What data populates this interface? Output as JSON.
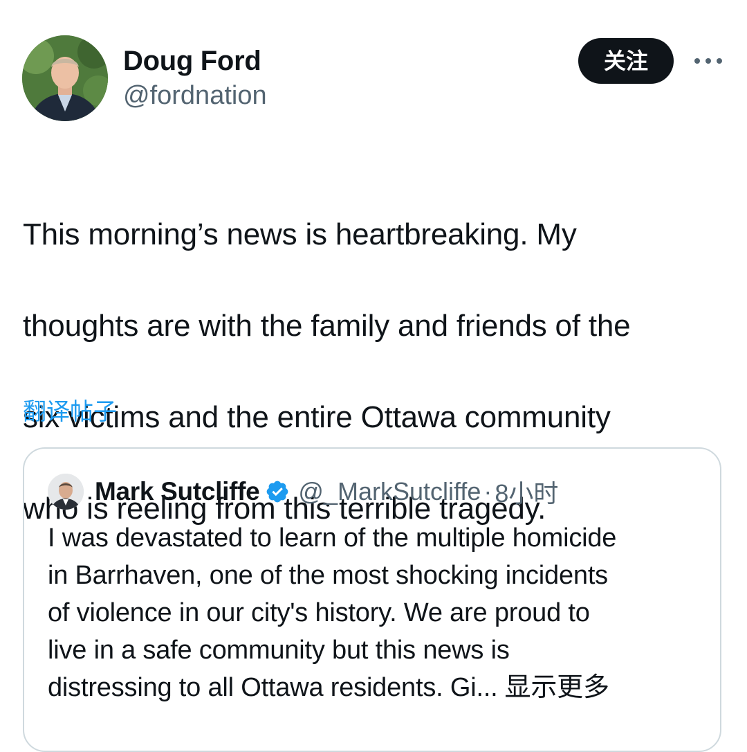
{
  "author": {
    "name": "Doug Ford",
    "handle": "@fordnation",
    "avatar_icon": "profile-photo"
  },
  "actions": {
    "follow_label": "关注",
    "more_icon": "more-horizontal-icon"
  },
  "tweet": {
    "text_lines": [
      "This morning’s news is heartbreaking. My",
      "thoughts are with the family and friends of the",
      "six victims and the entire Ottawa community",
      "who is reeling from this terrible tragedy."
    ],
    "translate_label": "翻译帖子"
  },
  "quoted_tweet": {
    "name": "Mark Sutcliffe",
    "verified": true,
    "handle": "@_MarkSutcliffe",
    "separator": "·",
    "time": "8小时",
    "text_lines": [
      "I was devastated to learn of the multiple homicide",
      "in Barrhaven, one of the most shocking incidents",
      "of violence in our city's history. We are proud to",
      "live in a safe community but this news is",
      "distressing to all Ottawa residents. Gi..."
    ],
    "show_more_label": "显示更多"
  },
  "colors": {
    "text_primary": "#0f1419",
    "text_secondary": "#536471",
    "link_blue": "#1d9bf0",
    "verified_blue": "#1d9bf0",
    "follow_bg": "#0f1419",
    "card_border": "#cfd9de"
  }
}
